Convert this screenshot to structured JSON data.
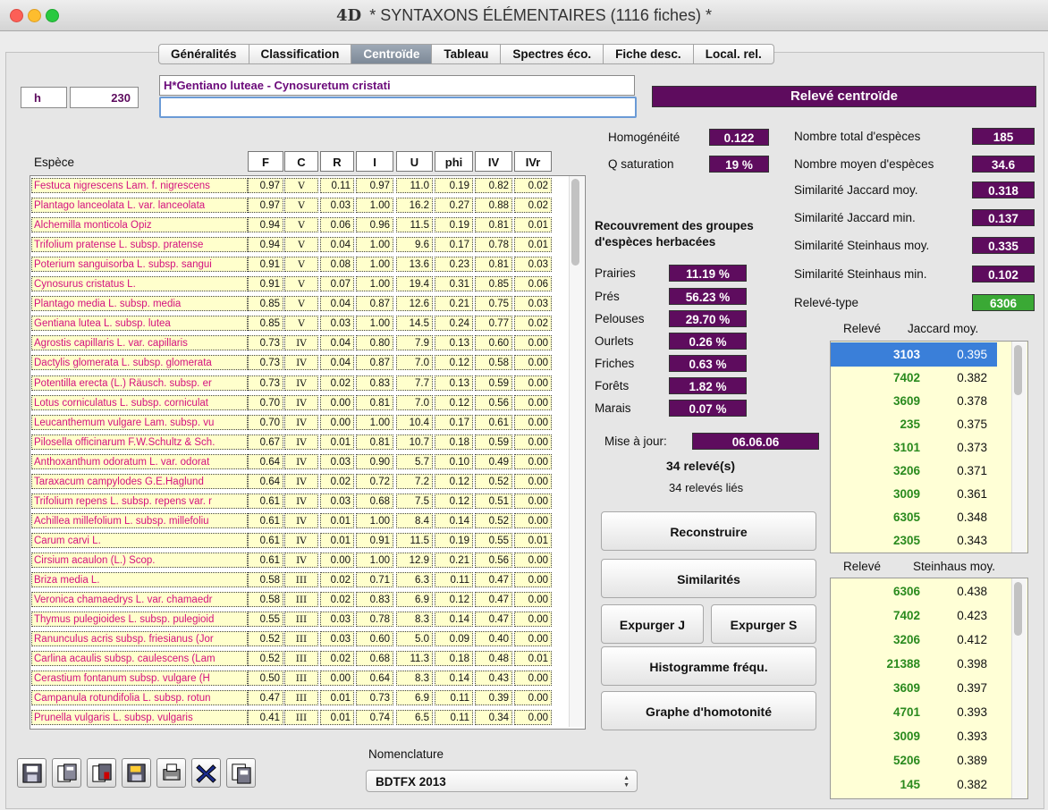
{
  "window": {
    "logo": "4D",
    "title": "* SYNTAXONS ÉLÉMENTAIRES (1116 fiches) *"
  },
  "tabs": [
    {
      "label": "Généralités"
    },
    {
      "label": "Classification"
    },
    {
      "label": "Centroïde",
      "active": true
    },
    {
      "label": "Tableau"
    },
    {
      "label": "Spectres éco."
    },
    {
      "label": "Fiche desc."
    },
    {
      "label": "Local. rel."
    }
  ],
  "record": {
    "type": "h",
    "number": "230",
    "name": "H*Gentiano luteae - Cynosuretum cristati",
    "edit_value": ""
  },
  "banner": "Relevé centroïde",
  "table": {
    "species_header": "Espèce",
    "columns": [
      "F",
      "C",
      "R",
      "I",
      "U",
      "phi",
      "IV",
      "IVr"
    ],
    "rows": [
      [
        "Festuca nigrescens Lam. f. nigrescens",
        "0.97",
        "V",
        "0.11",
        "0.97",
        "11.0",
        "0.19",
        "0.82",
        "0.02"
      ],
      [
        "Plantago lanceolata L. var. lanceolata",
        "0.97",
        "V",
        "0.03",
        "1.00",
        "16.2",
        "0.27",
        "0.88",
        "0.02"
      ],
      [
        "Alchemilla monticola Opiz",
        "0.94",
        "V",
        "0.06",
        "0.96",
        "11.5",
        "0.19",
        "0.81",
        "0.01"
      ],
      [
        "Trifolium pratense L. subsp. pratense",
        "0.94",
        "V",
        "0.04",
        "1.00",
        "9.6",
        "0.17",
        "0.78",
        "0.01"
      ],
      [
        "Poterium sanguisorba L. subsp. sangui",
        "0.91",
        "V",
        "0.08",
        "1.00",
        "13.6",
        "0.23",
        "0.81",
        "0.03"
      ],
      [
        "Cynosurus cristatus L.",
        "0.91",
        "V",
        "0.07",
        "1.00",
        "19.4",
        "0.31",
        "0.85",
        "0.06"
      ],
      [
        "Plantago media L. subsp. media",
        "0.85",
        "V",
        "0.04",
        "0.87",
        "12.6",
        "0.21",
        "0.75",
        "0.03"
      ],
      [
        "Gentiana lutea L. subsp. lutea",
        "0.85",
        "V",
        "0.03",
        "1.00",
        "14.5",
        "0.24",
        "0.77",
        "0.02"
      ],
      [
        "Agrostis capillaris L. var. capillaris",
        "0.73",
        "IV",
        "0.04",
        "0.80",
        "7.9",
        "0.13",
        "0.60",
        "0.00"
      ],
      [
        "Dactylis glomerata L. subsp. glomerata",
        "0.73",
        "IV",
        "0.04",
        "0.87",
        "7.0",
        "0.12",
        "0.58",
        "0.00"
      ],
      [
        "Potentilla erecta (L.) Räusch. subsp. er",
        "0.73",
        "IV",
        "0.02",
        "0.83",
        "7.7",
        "0.13",
        "0.59",
        "0.00"
      ],
      [
        "Lotus corniculatus L. subsp. corniculat",
        "0.70",
        "IV",
        "0.00",
        "0.81",
        "7.0",
        "0.12",
        "0.56",
        "0.00"
      ],
      [
        "Leucanthemum vulgare Lam. subsp. vu",
        "0.70",
        "IV",
        "0.00",
        "1.00",
        "10.4",
        "0.17",
        "0.61",
        "0.00"
      ],
      [
        "Pilosella officinarum F.W.Schultz & Sch.",
        "0.67",
        "IV",
        "0.01",
        "0.81",
        "10.7",
        "0.18",
        "0.59",
        "0.00"
      ],
      [
        "Anthoxanthum odoratum L. var. odorat",
        "0.64",
        "IV",
        "0.03",
        "0.90",
        "5.7",
        "0.10",
        "0.49",
        "0.00"
      ],
      [
        "Taraxacum campylodes G.E.Haglund",
        "0.64",
        "IV",
        "0.02",
        "0.72",
        "7.2",
        "0.12",
        "0.52",
        "0.00"
      ],
      [
        "Trifolium repens L. subsp. repens var. r",
        "0.61",
        "IV",
        "0.03",
        "0.68",
        "7.5",
        "0.12",
        "0.51",
        "0.00"
      ],
      [
        "Achillea millefolium L. subsp. millefoliu",
        "0.61",
        "IV",
        "0.01",
        "1.00",
        "8.4",
        "0.14",
        "0.52",
        "0.00"
      ],
      [
        "Carum carvi L.",
        "0.61",
        "IV",
        "0.01",
        "0.91",
        "11.5",
        "0.19",
        "0.55",
        "0.01"
      ],
      [
        "Cirsium acaulon (L.) Scop.",
        "0.61",
        "IV",
        "0.00",
        "1.00",
        "12.9",
        "0.21",
        "0.56",
        "0.00"
      ],
      [
        "Briza media L.",
        "0.58",
        "III",
        "0.02",
        "0.71",
        "6.3",
        "0.11",
        "0.47",
        "0.00"
      ],
      [
        "Veronica chamaedrys L. var. chamaedr",
        "0.58",
        "III",
        "0.02",
        "0.83",
        "6.9",
        "0.12",
        "0.47",
        "0.00"
      ],
      [
        "Thymus pulegioides L. subsp. pulegioid",
        "0.55",
        "III",
        "0.03",
        "0.78",
        "8.3",
        "0.14",
        "0.47",
        "0.00"
      ],
      [
        "Ranunculus acris subsp. friesianus (Jor",
        "0.52",
        "III",
        "0.03",
        "0.60",
        "5.0",
        "0.09",
        "0.40",
        "0.00"
      ],
      [
        "Carlina acaulis subsp. caulescens (Lam",
        "0.52",
        "III",
        "0.02",
        "0.68",
        "11.3",
        "0.18",
        "0.48",
        "0.01"
      ],
      [
        "Cerastium fontanum subsp. vulgare (H",
        "0.50",
        "III",
        "0.00",
        "0.64",
        "8.3",
        "0.14",
        "0.43",
        "0.00"
      ],
      [
        "Campanula rotundifolia L. subsp. rotun",
        "0.47",
        "III",
        "0.01",
        "0.73",
        "6.9",
        "0.11",
        "0.39",
        "0.00"
      ],
      [
        "Prunella vulgaris L. subsp. vulgaris",
        "0.41",
        "III",
        "0.01",
        "0.74",
        "6.5",
        "0.11",
        "0.34",
        "0.00"
      ]
    ]
  },
  "homogeneity": {
    "label": "Homogénéité",
    "value": "0.122"
  },
  "saturation": {
    "label": "Q saturation",
    "value": "19 %"
  },
  "recouvrement": {
    "title_line1": "Recouvrement des groupes",
    "title_line2": "d'espèces herbacées",
    "groups": [
      {
        "label": "Prairies",
        "value": "11.19 %"
      },
      {
        "label": "Prés",
        "value": "56.23 %"
      },
      {
        "label": "Pelouses",
        "value": "29.70 %"
      },
      {
        "label": "Ourlets",
        "value": "0.26 %"
      },
      {
        "label": "Friches",
        "value": "0.63 %"
      },
      {
        "label": "Forêts",
        "value": "1.82 %"
      },
      {
        "label": "Marais",
        "value": "0.07 %"
      }
    ]
  },
  "update": {
    "label": "Mise à jour:",
    "value": "06.06.06",
    "count": "34 relevé(s)",
    "linked": "34 relevés liés"
  },
  "buttons": {
    "reconstruire": "Reconstruire",
    "similarites": "Similarités",
    "expurger_j": "Expurger J",
    "expurger_s": "Expurger S",
    "histogramme": "Histogramme fréqu.",
    "graphe": "Graphe d'homotonité"
  },
  "stats": [
    {
      "label": "Nombre total d'espèces",
      "value": "185"
    },
    {
      "label": "Nombre moyen d'espèces",
      "value": "34.6"
    },
    {
      "label": "Similarité Jaccard moy.",
      "value": "0.318"
    },
    {
      "label": "Similarité Jaccard min.",
      "value": "0.137"
    },
    {
      "label": "Similarité Steinhaus moy.",
      "value": "0.335"
    },
    {
      "label": "Similarité Steinhaus min.",
      "value": "0.102"
    },
    {
      "label": "Relevé-type",
      "value": "6306"
    }
  ],
  "jaccard_list": {
    "col1": "Relevé",
    "col2": "Jaccard moy.",
    "rows": [
      [
        "3103",
        "0.395"
      ],
      [
        "7402",
        "0.382"
      ],
      [
        "3609",
        "0.378"
      ],
      [
        "235",
        "0.375"
      ],
      [
        "3101",
        "0.373"
      ],
      [
        "3206",
        "0.371"
      ],
      [
        "3009",
        "0.361"
      ],
      [
        "6305",
        "0.348"
      ],
      [
        "2305",
        "0.343"
      ]
    ]
  },
  "steinhaus_list": {
    "col1": "Relevé",
    "col2": "Steinhaus moy.",
    "rows": [
      [
        "6306",
        "0.438"
      ],
      [
        "7402",
        "0.423"
      ],
      [
        "3206",
        "0.412"
      ],
      [
        "21388",
        "0.398"
      ],
      [
        "3609",
        "0.397"
      ],
      [
        "4701",
        "0.393"
      ],
      [
        "3009",
        "0.393"
      ],
      [
        "5206",
        "0.389"
      ],
      [
        "145",
        "0.382"
      ]
    ]
  },
  "toolbar": [
    "save-icon",
    "copy-icon",
    "paste-icon",
    "open-icon",
    "print-icon",
    "delete-icon",
    "duplicate-icon"
  ],
  "nomenclature": {
    "label": "Nomenclature",
    "selected": "BDTFX 2013"
  },
  "colors": {
    "purple": "#5e0c5e",
    "green": "#3aa935",
    "selection": "#3a7fd9",
    "species_text": "#d4117f",
    "cell_bg": "#ffffcc"
  }
}
